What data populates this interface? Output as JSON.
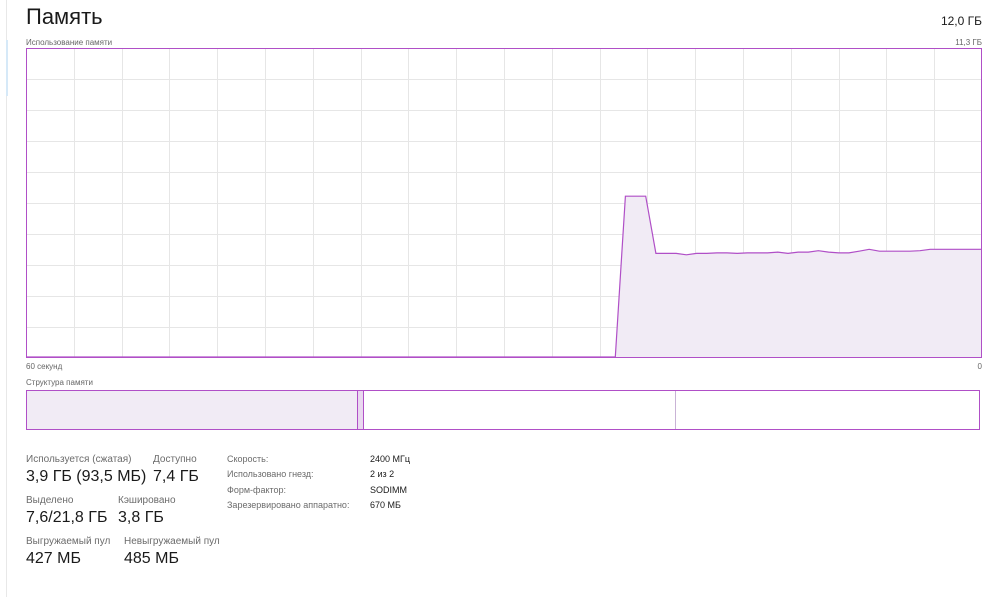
{
  "header": {
    "title": "Память",
    "total_memory": "12,0 ГБ",
    "usage_caption": "Использование памяти",
    "max_usage": "11,3 ГБ"
  },
  "graph": {
    "time_left_label": "60 секунд",
    "time_right_label": "0",
    "line_color": "#b04fc7",
    "fill_color": "#f1ebf5",
    "grid_color": "#e6e6e6",
    "max_gb": 11.3,
    "series_gb": [
      0,
      0,
      0,
      0,
      0,
      0,
      0,
      0,
      0,
      0,
      0,
      0,
      0,
      0,
      0,
      0,
      0,
      0,
      0,
      0,
      0,
      0,
      0,
      0,
      0,
      0,
      0,
      0,
      0,
      0,
      0,
      0,
      0,
      0,
      0,
      0,
      0,
      0,
      0,
      0,
      0,
      0,
      0,
      0,
      0,
      0,
      0,
      0,
      0,
      0,
      0,
      0,
      0,
      0,
      0,
      0,
      0,
      0,
      0,
      5.9,
      5.9,
      5.9,
      3.8,
      3.8,
      3.8,
      3.75,
      3.8,
      3.8,
      3.82,
      3.82,
      3.8,
      3.82,
      3.82,
      3.82,
      3.85,
      3.8,
      3.85,
      3.85,
      3.9,
      3.85,
      3.82,
      3.82,
      3.88,
      3.95,
      3.88,
      3.88,
      3.88,
      3.88,
      3.9,
      3.95,
      3.95,
      3.95,
      3.95,
      3.95,
      3.95
    ]
  },
  "composition": {
    "caption": "Структура памяти"
  },
  "stats": {
    "in_use_label": "Используется (сжатая)",
    "in_use_value": "3,9 ГБ (93,5 МБ)",
    "available_label": "Доступно",
    "available_value": "7,4 ГБ",
    "committed_label": "Выделено",
    "committed_value": "7,6/21,8 ГБ",
    "cached_label": "Кэшировано",
    "cached_value": "3,8 ГБ",
    "paged_label": "Выгружаемый пул",
    "paged_value": "427 МБ",
    "nonpaged_label": "Невыгружаемый пул",
    "nonpaged_value": "485 МБ"
  },
  "info": {
    "speed_label": "Скорость:",
    "speed_value": "2400 МГц",
    "slots_label": "Использовано гнезд:",
    "slots_value": "2 из 2",
    "form_label": "Форм-фактор:",
    "form_value": "SODIMM",
    "reserved_label": "Зарезервировано аппаратно:",
    "reserved_value": "670 МБ"
  }
}
